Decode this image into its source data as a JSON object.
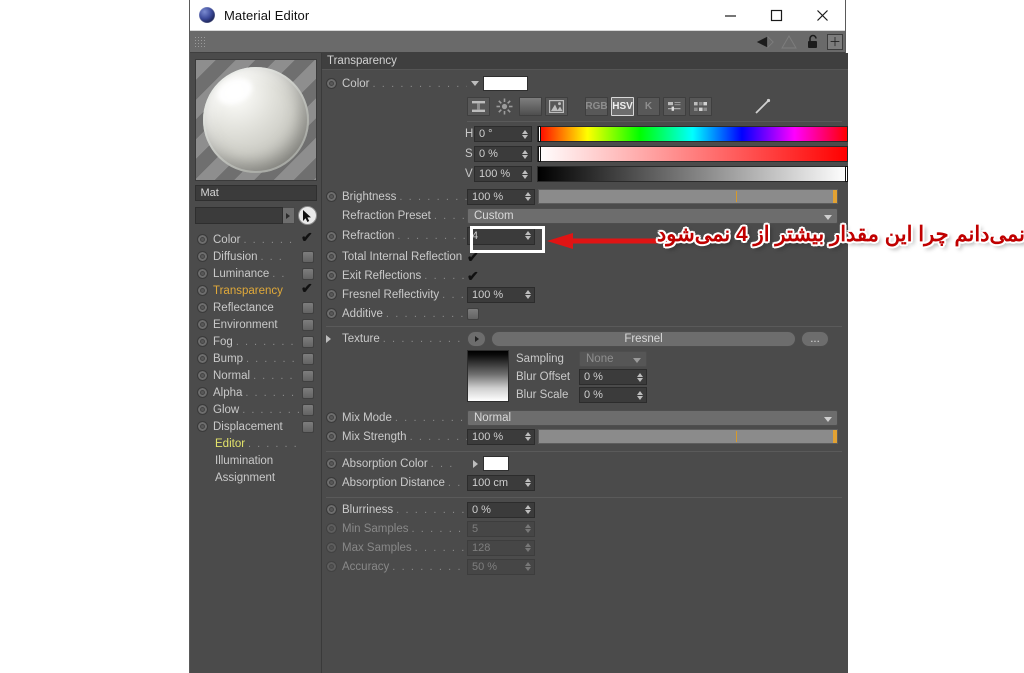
{
  "window": {
    "title": "Material Editor",
    "icon": "material-sphere-icon",
    "minimize_label": "minimize-icon",
    "maximize_label": "maximize-icon",
    "close_label": "close-icon"
  },
  "toolbar": {
    "grip": "drag-grip-icon",
    "icons": [
      "triangle-left-icon",
      "triangle-outline-icon",
      "lock-open-icon",
      "add-view-icon"
    ]
  },
  "sidebar": {
    "preview": {
      "name": "material-preview-sphere"
    },
    "material_name": "Mat",
    "search_value": "",
    "cursor_button": "pick-cursor-icon",
    "channels": [
      {
        "label": "Color",
        "dots": ". . . . . .",
        "checked": true,
        "enabled": true,
        "highlight": false,
        "hasbox": true
      },
      {
        "label": "Diffusion",
        "dots": ". . .",
        "checked": false,
        "enabled": true,
        "highlight": false,
        "hasbox": true
      },
      {
        "label": "Luminance",
        "dots": ". .",
        "checked": false,
        "enabled": true,
        "highlight": false,
        "hasbox": true
      },
      {
        "label": "Transparency",
        "dots": "",
        "checked": true,
        "enabled": true,
        "highlight": true,
        "hasbox": true
      },
      {
        "label": "Reflectance",
        "dots": "",
        "checked": false,
        "enabled": true,
        "highlight": false,
        "hasbox": true
      },
      {
        "label": "Environment",
        "dots": "",
        "checked": false,
        "enabled": true,
        "highlight": false,
        "hasbox": true
      },
      {
        "label": "Fog",
        "dots": ". . . . . . .",
        "checked": false,
        "enabled": true,
        "highlight": false,
        "hasbox": true
      },
      {
        "label": "Bump",
        "dots": ". . . . . .",
        "checked": false,
        "enabled": true,
        "highlight": false,
        "hasbox": true
      },
      {
        "label": "Normal",
        "dots": ". . . . .",
        "checked": false,
        "enabled": true,
        "highlight": false,
        "hasbox": true
      },
      {
        "label": "Alpha",
        "dots": ". . . . . .",
        "checked": false,
        "enabled": true,
        "highlight": false,
        "hasbox": true
      },
      {
        "label": "Glow",
        "dots": ". . . . . . .",
        "checked": false,
        "enabled": true,
        "highlight": false,
        "hasbox": true
      },
      {
        "label": "Displacement",
        "dots": "",
        "checked": false,
        "enabled": true,
        "highlight": false,
        "hasbox": true
      }
    ],
    "sub_items": [
      {
        "label": "Editor",
        "dots": ". . . . . .",
        "color": "yellow"
      },
      {
        "label": "Illumination",
        "dots": "",
        "color": "normal"
      },
      {
        "label": "Assignment",
        "dots": "",
        "color": "normal"
      }
    ]
  },
  "panel": {
    "section_title": "Transparency",
    "color": {
      "label": "Color",
      "dots": ". . . . . . . . . . . .",
      "swatch_hex": "#ffffff",
      "mode_buttons": [
        {
          "name": "color-range-icon",
          "label": "",
          "active": false
        },
        {
          "name": "color-wheel-icon",
          "label": "",
          "active": false
        },
        {
          "name": "gradient-icon",
          "label": "",
          "active": false
        },
        {
          "name": "image-picker-icon",
          "label": "",
          "active": false
        },
        {
          "name": "rgb-mode-button",
          "label": "RGB",
          "active": false
        },
        {
          "name": "hsv-mode-button",
          "label": "HSV",
          "active": true
        },
        {
          "name": "k-mode-button",
          "label": "K",
          "active": false
        },
        {
          "name": "sliders-icon",
          "label": "",
          "active": false
        },
        {
          "name": "swatches-icon",
          "label": "",
          "active": false
        },
        {
          "name": "eyedropper-icon",
          "label": "",
          "active": false
        }
      ],
      "hsv": [
        {
          "key": "H",
          "value": "0 °",
          "pos_pct": 0
        },
        {
          "key": "S",
          "value": "0 %",
          "pos_pct": 0
        },
        {
          "key": "V",
          "value": "100 %",
          "pos_pct": 100
        }
      ]
    },
    "brightness": {
      "label": "Brightness",
      "dots": ". . . . . . . . . .",
      "value": "100 %",
      "slider_pct": 100,
      "tick_pct": 66
    },
    "refraction_preset": {
      "label": "Refraction Preset",
      "dots": ". . . . . .",
      "value": "Custom"
    },
    "refraction": {
      "label": "Refraction",
      "dots": ". . . . . . . . . .",
      "value": "4"
    },
    "total_internal_reflection": {
      "label": "Total Internal Reflection",
      "dots": "",
      "checked": true
    },
    "exit_reflections": {
      "label": "Exit Reflections",
      "dots": ". . . . . . .",
      "checked": true
    },
    "fresnel_reflectivity": {
      "label": "Fresnel Reflectivity",
      "dots": ". . . .",
      "value": "100 %"
    },
    "additive": {
      "label": "Additive",
      "dots": ". . . . . . . . . . .",
      "checked": false
    },
    "texture": {
      "label": "Texture",
      "dots": ". . . . . . . . . . .",
      "value": "Fresnel",
      "more_label": "..."
    },
    "sampling": {
      "label": "Sampling",
      "value": "None"
    },
    "blur_offset": {
      "label": "Blur Offset",
      "value": "0 %"
    },
    "blur_scale": {
      "label": "Blur Scale",
      "value": "0 %"
    },
    "mix_mode": {
      "label": "Mix Mode",
      "dots": ". . . . . . . . . .",
      "value": "Normal"
    },
    "mix_strength": {
      "label": "Mix Strength",
      "dots": ". . . . . . . . .",
      "value": "100 %",
      "slider_pct": 100,
      "tick_pct": 66
    },
    "absorption_color": {
      "label": "Absorption Color",
      "dots": ". . .",
      "swatch_hex": "#ffffff"
    },
    "absorption_distance": {
      "label": "Absorption Distance",
      "dots": ". . .",
      "value": "100 cm"
    },
    "blurriness": {
      "label": "Blurriness",
      "dots": ". . . . . . . . . . .",
      "value": "0 %",
      "enabled": true
    },
    "min_samples": {
      "label": "Min Samples",
      "dots": ". . . . . . . . .",
      "value": "5",
      "enabled": false
    },
    "max_samples": {
      "label": "Max Samples",
      "dots": ". . . . . . . . .",
      "value": "128",
      "enabled": false
    },
    "accuracy": {
      "label": "Accuracy",
      "dots": ". . . . . . . . . . . .",
      "value": "50 %",
      "enabled": false
    }
  },
  "annotation": {
    "text": "نمی‌دانم چرا این مقدار بیشتر از 4 نمی‌شود",
    "arrow": "left-arrow-annotation",
    "highlight_box": "refraction-field-highlight",
    "color": "#c00000",
    "outline_color": "#ffffff"
  }
}
